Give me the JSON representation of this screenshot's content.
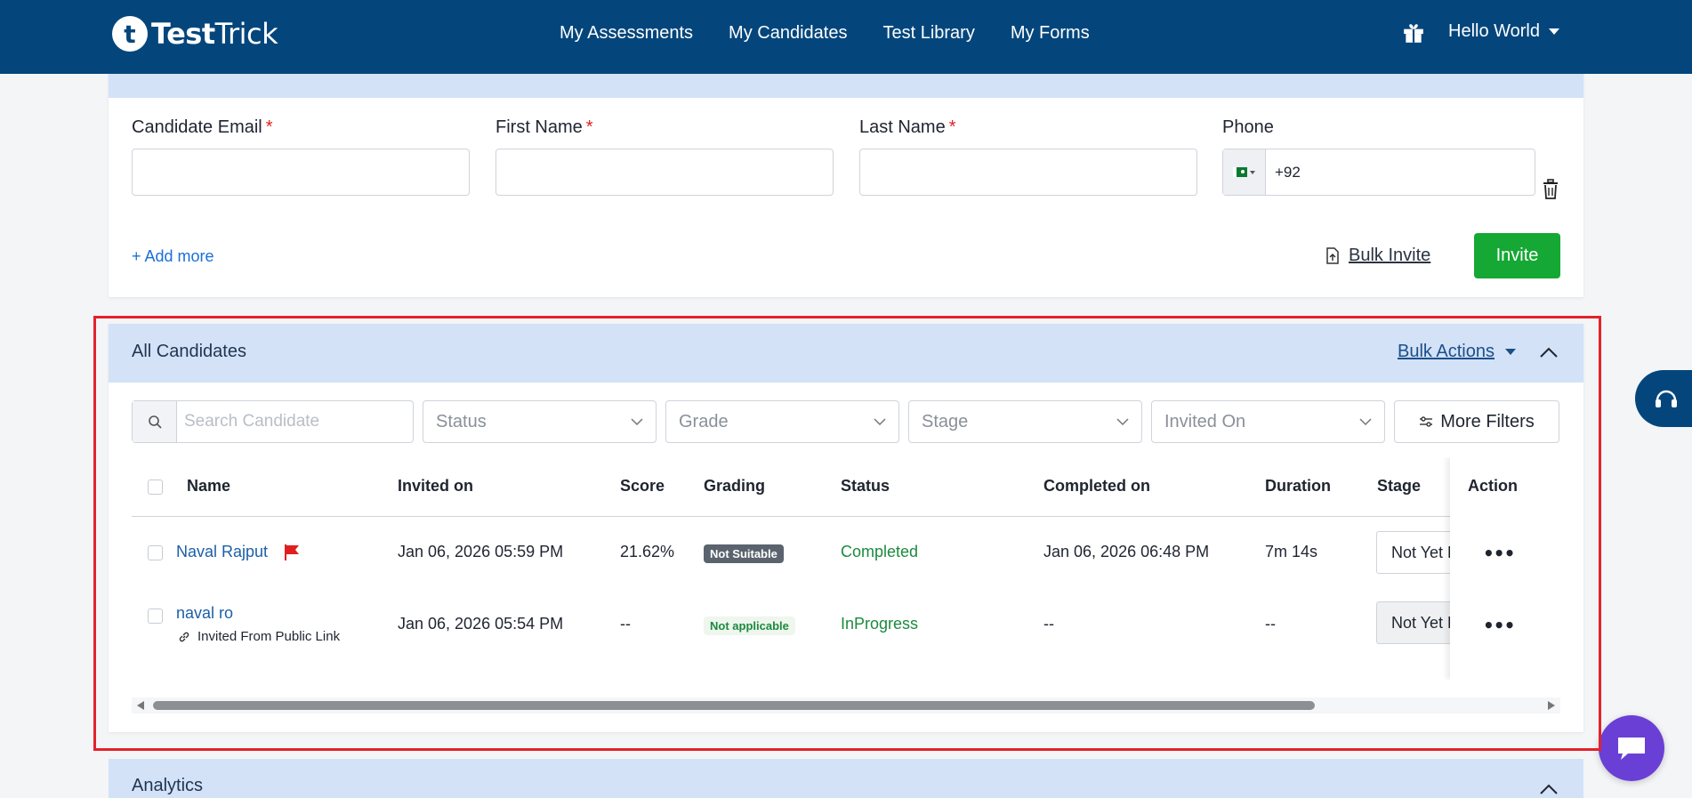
{
  "brand": {
    "logo_mark": "t",
    "name_bold": "Test",
    "name_regular": "Trick"
  },
  "nav": {
    "links": [
      "My Assessments",
      "My Candidates",
      "Test Library",
      "My Forms"
    ],
    "user": "Hello World",
    "gift_icon": "gift-icon"
  },
  "invite": {
    "fields": [
      {
        "label": "Candidate Email",
        "required": "*"
      },
      {
        "label": "First Name",
        "required": "*"
      },
      {
        "label": "Last Name",
        "required": "*"
      }
    ],
    "phone": {
      "label": "Phone",
      "code": "+92",
      "country": "PK"
    },
    "add_more": "+ Add more",
    "bulk_invite": "Bulk Invite",
    "invite_button": "Invite"
  },
  "candidates": {
    "title": "All Candidates",
    "bulk_actions": "Bulk Actions",
    "filters": {
      "search_placeholder": "Search Candidate",
      "status": "Status",
      "grade": "Grade",
      "stage": "Stage",
      "invited_on": "Invited On",
      "more_filters": "More Filters"
    },
    "columns": [
      "Name",
      "Invited on",
      "Score",
      "Grading",
      "Status",
      "Completed on",
      "Duration",
      "Stage",
      "Action"
    ],
    "rows": [
      {
        "name": "Naval Rajput",
        "flag_icon": "red-flag-icon",
        "invited_on": "Jan 06, 2026 05:59 PM",
        "score": "21.62%",
        "grading": "Not Suitable",
        "status": "Completed",
        "completed_on": "Jan 06, 2026 06:48 PM",
        "duration": "7m 14s",
        "stage": "Not Yet Evaluated",
        "action": "•••"
      },
      {
        "name": "naval ro",
        "sub_note": "Invited From Public Link",
        "invited_on": "Jan 06, 2026 05:54 PM",
        "score": "--",
        "grading": "Not applicable",
        "status": "InProgress",
        "completed_on": "--",
        "duration": "--",
        "stage": "Not Yet Evaluated",
        "action": "•••"
      }
    ]
  },
  "analytics": {
    "title": "Analytics"
  },
  "colors": {
    "nav_bg": "#04467c",
    "header_bg": "#d3e2f7",
    "invite_green": "#15a834",
    "highlight": "#e3222b",
    "chat": "#6a3fd6"
  }
}
